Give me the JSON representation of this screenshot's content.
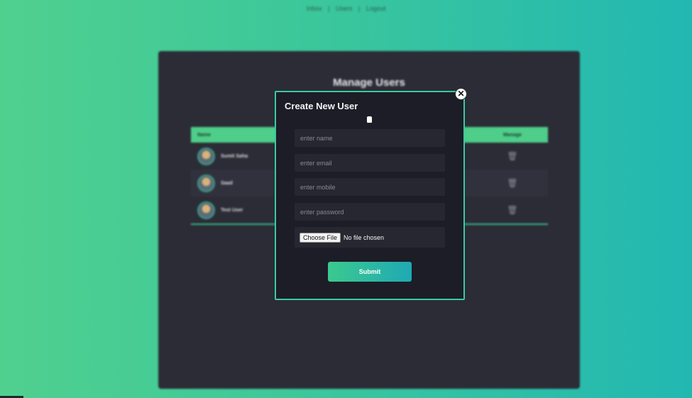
{
  "nav": {
    "inbox": "Inbox",
    "users": "Users",
    "logout": "Logout",
    "sep": "|"
  },
  "page": {
    "title": "Manage Users"
  },
  "table": {
    "headers": {
      "name": "Name",
      "manage": "Manage"
    },
    "rows": [
      {
        "name": "Sumit Saha"
      },
      {
        "name": "Saad"
      },
      {
        "name": "Test User"
      }
    ]
  },
  "modal": {
    "title": "Create New User",
    "close_glyph": "✕",
    "fields": {
      "name_placeholder": "enter name",
      "email_placeholder": "enter email",
      "mobile_placeholder": "enter mobile",
      "password_placeholder": "enter password"
    },
    "file": {
      "button_label": "Choose File",
      "status": "No file chosen"
    },
    "submit_label": "Submit"
  },
  "colors": {
    "accent_green": "#4ece89",
    "accent_teal": "#1fa9b4",
    "panel_bg": "#2b2c36",
    "modal_bg": "#1c1d26"
  },
  "icons": {
    "delete": "trash-icon",
    "close": "close-icon",
    "avatar": "avatar-icon"
  }
}
